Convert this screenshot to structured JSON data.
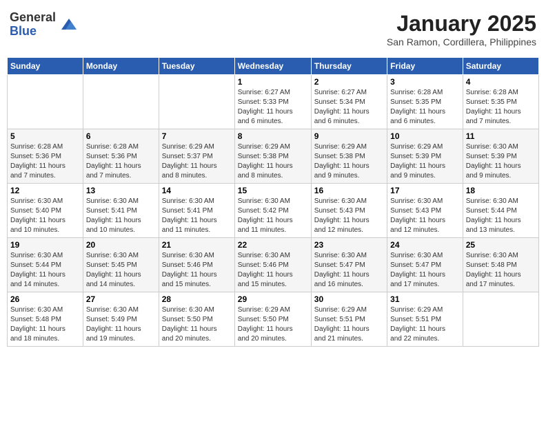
{
  "header": {
    "logo_general": "General",
    "logo_blue": "Blue",
    "month_title": "January 2025",
    "location": "San Ramon, Cordillera, Philippines"
  },
  "days_of_week": [
    "Sunday",
    "Monday",
    "Tuesday",
    "Wednesday",
    "Thursday",
    "Friday",
    "Saturday"
  ],
  "weeks": [
    [
      {
        "day": "",
        "info": ""
      },
      {
        "day": "",
        "info": ""
      },
      {
        "day": "",
        "info": ""
      },
      {
        "day": "1",
        "info": "Sunrise: 6:27 AM\nSunset: 5:33 PM\nDaylight: 11 hours\nand 6 minutes."
      },
      {
        "day": "2",
        "info": "Sunrise: 6:27 AM\nSunset: 5:34 PM\nDaylight: 11 hours\nand 6 minutes."
      },
      {
        "day": "3",
        "info": "Sunrise: 6:28 AM\nSunset: 5:35 PM\nDaylight: 11 hours\nand 6 minutes."
      },
      {
        "day": "4",
        "info": "Sunrise: 6:28 AM\nSunset: 5:35 PM\nDaylight: 11 hours\nand 7 minutes."
      }
    ],
    [
      {
        "day": "5",
        "info": "Sunrise: 6:28 AM\nSunset: 5:36 PM\nDaylight: 11 hours\nand 7 minutes."
      },
      {
        "day": "6",
        "info": "Sunrise: 6:28 AM\nSunset: 5:36 PM\nDaylight: 11 hours\nand 7 minutes."
      },
      {
        "day": "7",
        "info": "Sunrise: 6:29 AM\nSunset: 5:37 PM\nDaylight: 11 hours\nand 8 minutes."
      },
      {
        "day": "8",
        "info": "Sunrise: 6:29 AM\nSunset: 5:38 PM\nDaylight: 11 hours\nand 8 minutes."
      },
      {
        "day": "9",
        "info": "Sunrise: 6:29 AM\nSunset: 5:38 PM\nDaylight: 11 hours\nand 9 minutes."
      },
      {
        "day": "10",
        "info": "Sunrise: 6:29 AM\nSunset: 5:39 PM\nDaylight: 11 hours\nand 9 minutes."
      },
      {
        "day": "11",
        "info": "Sunrise: 6:30 AM\nSunset: 5:39 PM\nDaylight: 11 hours\nand 9 minutes."
      }
    ],
    [
      {
        "day": "12",
        "info": "Sunrise: 6:30 AM\nSunset: 5:40 PM\nDaylight: 11 hours\nand 10 minutes."
      },
      {
        "day": "13",
        "info": "Sunrise: 6:30 AM\nSunset: 5:41 PM\nDaylight: 11 hours\nand 10 minutes."
      },
      {
        "day": "14",
        "info": "Sunrise: 6:30 AM\nSunset: 5:41 PM\nDaylight: 11 hours\nand 11 minutes."
      },
      {
        "day": "15",
        "info": "Sunrise: 6:30 AM\nSunset: 5:42 PM\nDaylight: 11 hours\nand 11 minutes."
      },
      {
        "day": "16",
        "info": "Sunrise: 6:30 AM\nSunset: 5:43 PM\nDaylight: 11 hours\nand 12 minutes."
      },
      {
        "day": "17",
        "info": "Sunrise: 6:30 AM\nSunset: 5:43 PM\nDaylight: 11 hours\nand 12 minutes."
      },
      {
        "day": "18",
        "info": "Sunrise: 6:30 AM\nSunset: 5:44 PM\nDaylight: 11 hours\nand 13 minutes."
      }
    ],
    [
      {
        "day": "19",
        "info": "Sunrise: 6:30 AM\nSunset: 5:44 PM\nDaylight: 11 hours\nand 14 minutes."
      },
      {
        "day": "20",
        "info": "Sunrise: 6:30 AM\nSunset: 5:45 PM\nDaylight: 11 hours\nand 14 minutes."
      },
      {
        "day": "21",
        "info": "Sunrise: 6:30 AM\nSunset: 5:46 PM\nDaylight: 11 hours\nand 15 minutes."
      },
      {
        "day": "22",
        "info": "Sunrise: 6:30 AM\nSunset: 5:46 PM\nDaylight: 11 hours\nand 15 minutes."
      },
      {
        "day": "23",
        "info": "Sunrise: 6:30 AM\nSunset: 5:47 PM\nDaylight: 11 hours\nand 16 minutes."
      },
      {
        "day": "24",
        "info": "Sunrise: 6:30 AM\nSunset: 5:47 PM\nDaylight: 11 hours\nand 17 minutes."
      },
      {
        "day": "25",
        "info": "Sunrise: 6:30 AM\nSunset: 5:48 PM\nDaylight: 11 hours\nand 17 minutes."
      }
    ],
    [
      {
        "day": "26",
        "info": "Sunrise: 6:30 AM\nSunset: 5:48 PM\nDaylight: 11 hours\nand 18 minutes."
      },
      {
        "day": "27",
        "info": "Sunrise: 6:30 AM\nSunset: 5:49 PM\nDaylight: 11 hours\nand 19 minutes."
      },
      {
        "day": "28",
        "info": "Sunrise: 6:30 AM\nSunset: 5:50 PM\nDaylight: 11 hours\nand 20 minutes."
      },
      {
        "day": "29",
        "info": "Sunrise: 6:29 AM\nSunset: 5:50 PM\nDaylight: 11 hours\nand 20 minutes."
      },
      {
        "day": "30",
        "info": "Sunrise: 6:29 AM\nSunset: 5:51 PM\nDaylight: 11 hours\nand 21 minutes."
      },
      {
        "day": "31",
        "info": "Sunrise: 6:29 AM\nSunset: 5:51 PM\nDaylight: 11 hours\nand 22 minutes."
      },
      {
        "day": "",
        "info": ""
      }
    ]
  ]
}
